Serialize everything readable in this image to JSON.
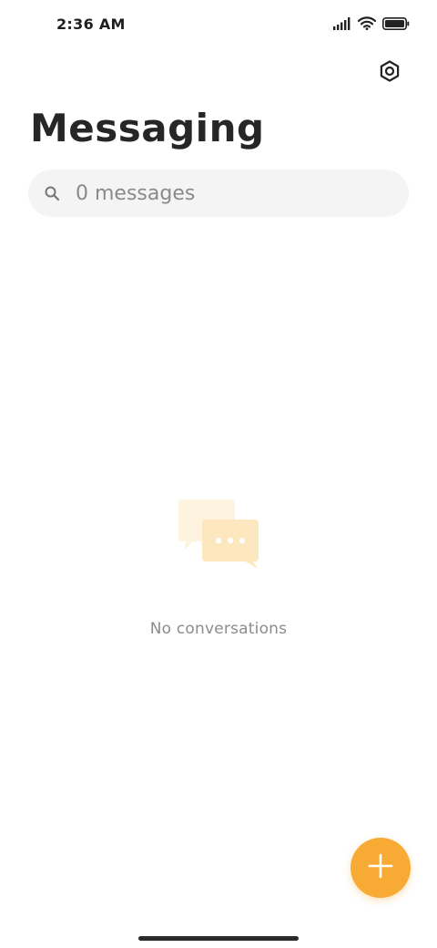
{
  "status_bar": {
    "time": "2:36 AM",
    "icons": [
      "signal-icon",
      "wifi-icon",
      "battery-icon"
    ]
  },
  "header": {
    "title": "Messaging",
    "settings_icon": "settings-icon"
  },
  "search": {
    "placeholder": "0 messages",
    "value": "",
    "icon": "search-icon"
  },
  "empty_state": {
    "icon": "chat-bubbles-icon",
    "text": "No conversations"
  },
  "fab": {
    "icon": "plus-icon"
  },
  "colors": {
    "accent": "#f7ab35",
    "search_bg": "#f4f4f4",
    "illustration_light": "#fdf3df",
    "illustration_main": "#fde7bf"
  }
}
